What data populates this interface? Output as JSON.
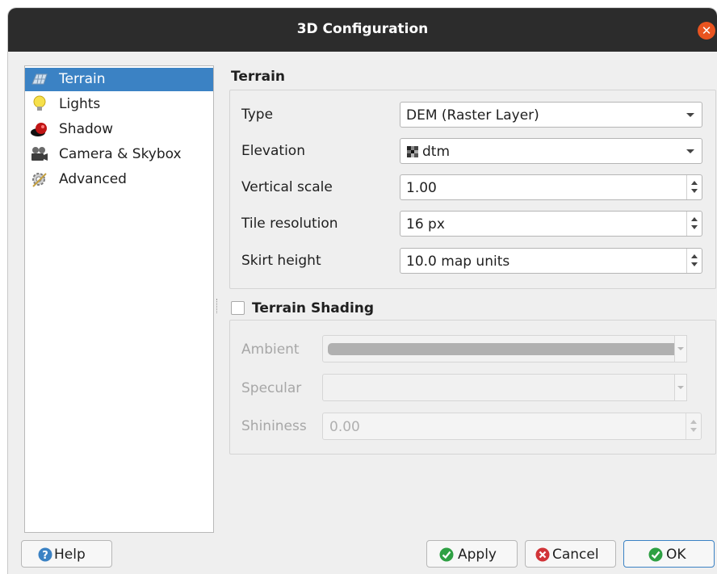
{
  "window": {
    "title": "3D Configuration"
  },
  "sidebar": {
    "items": [
      {
        "label": "Terrain",
        "icon": "terrain-icon",
        "selected": true
      },
      {
        "label": "Lights",
        "icon": "lightbulb-icon",
        "selected": false
      },
      {
        "label": "Shadow",
        "icon": "shadow-icon",
        "selected": false
      },
      {
        "label": "Camera & Skybox",
        "icon": "camera-icon",
        "selected": false
      },
      {
        "label": "Advanced",
        "icon": "advanced-icon",
        "selected": false
      }
    ]
  },
  "terrain": {
    "section_title": "Terrain",
    "type_label": "Type",
    "type_value": "DEM (Raster Layer)",
    "elevation_label": "Elevation",
    "elevation_value": "dtm",
    "vertical_scale_label": "Vertical scale",
    "vertical_scale_value": "1.00",
    "tile_resolution_label": "Tile resolution",
    "tile_resolution_value": "16 px",
    "skirt_height_label": "Skirt height",
    "skirt_height_value": "10.0 map units"
  },
  "shading": {
    "title": "Terrain Shading",
    "checked": false,
    "ambient_label": "Ambient",
    "specular_label": "Specular",
    "shininess_label": "Shininess",
    "shininess_value": "0.00"
  },
  "buttons": {
    "help": "Help",
    "apply": "Apply",
    "cancel": "Cancel",
    "ok": "OK"
  },
  "colors": {
    "selection": "#3b82c4",
    "titlebar": "#2c2c2c",
    "close": "#e95420",
    "apply_icon": "#2ea043",
    "cancel_icon": "#d13438",
    "help_icon": "#3b82c4"
  }
}
